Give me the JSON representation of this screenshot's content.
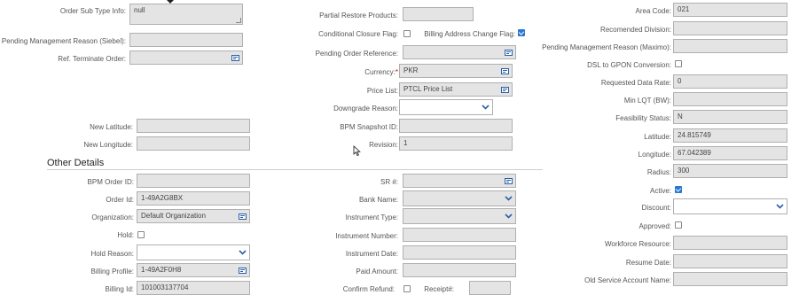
{
  "col1": {
    "order_sub_type_info": {
      "label": "Order Sub Type Info:",
      "value": "null"
    },
    "pending_mgmt_reason_siebel": {
      "label": "Pending Management Reason (Siebel):",
      "value": ""
    },
    "ref_terminate_order": {
      "label": "Ref. Terminate Order:",
      "value": ""
    },
    "new_latitude": {
      "label": "New Latitude:",
      "value": ""
    },
    "new_longitude": {
      "label": "New Longitude:",
      "value": ""
    }
  },
  "col2": {
    "partial_restore_products": {
      "label": "Partial Restore Products:",
      "value": ""
    },
    "conditional_closure_flag": {
      "label": "Conditional Closure Flag:",
      "checked": false
    },
    "billing_address_change_flag": {
      "label": "Billing Address Change Flag:",
      "checked": true
    },
    "pending_order_reference": {
      "label": "Pending Order Reference:",
      "value": ""
    },
    "currency": {
      "label": "Currency:",
      "required_mark": "*",
      "value": "PKR"
    },
    "price_list": {
      "label": "Price List:",
      "value": "PTCL Price List"
    },
    "downgrade_reason": {
      "label": "Downgrade Reason:",
      "value": ""
    },
    "bpm_snapshot_id": {
      "label": "BPM Snapshot ID:",
      "value": ""
    },
    "revision": {
      "label": "Revision:",
      "value": "1"
    }
  },
  "col3": {
    "area_code": {
      "label": "Area Code:",
      "value": "021"
    },
    "recommended_division": {
      "label": "Recomended Division:",
      "value": ""
    },
    "pending_mgmt_reason_maximo": {
      "label": "Pending Management Reason (Maximo):",
      "value": ""
    },
    "dsl_to_gpon": {
      "label": "DSL to GPON Conversion:",
      "checked": false
    },
    "requested_data_rate": {
      "label": "Requested Data Rate:",
      "value": "0"
    },
    "min_lqt": {
      "label": "Min LQT (BW):",
      "value": ""
    },
    "feasibility_status": {
      "label": "Feasibility Status:",
      "value": "N"
    },
    "latitude": {
      "label": "Latitude:",
      "value": "24.815749"
    },
    "longitude": {
      "label": "Longitude:",
      "value": "67.042389"
    },
    "radius": {
      "label": "Radius:",
      "value": "300"
    },
    "active": {
      "label": "Active:",
      "checked": true
    },
    "discount": {
      "label": "Discount:",
      "value": ""
    },
    "approved": {
      "label": "Approved:",
      "checked": false
    },
    "workforce_resource": {
      "label": "Workforce Resource:",
      "value": ""
    },
    "resume_date": {
      "label": "Resume Date:",
      "value": ""
    },
    "old_service_account_name": {
      "label": "Old Service Account Name:",
      "value": ""
    }
  },
  "other_details": {
    "title": "Other Details",
    "bpm_order_id": {
      "label": "BPM Order ID:",
      "value": ""
    },
    "order_id": {
      "label": "Order Id:",
      "value": "1-49A2G8BX"
    },
    "organization": {
      "label": "Organization:",
      "value": "Default Organization"
    },
    "hold": {
      "label": "Hold:",
      "checked": false
    },
    "hold_reason": {
      "label": "Hold Reason:",
      "value": ""
    },
    "billing_profile": {
      "label": "Billing Profile:",
      "value": "1-49A2F0H8"
    },
    "billing_id": {
      "label": "Billing Id:",
      "value": "101003137704"
    },
    "sr_number": {
      "label": "SR #:",
      "value": ""
    },
    "bank_name": {
      "label": "Bank Name:",
      "value": ""
    },
    "instrument_type": {
      "label": "Instrument Type:",
      "value": ""
    },
    "instrument_number": {
      "label": "Instrument Number:",
      "value": ""
    },
    "instrument_date": {
      "label": "Instrument Date:",
      "value": ""
    },
    "paid_amount": {
      "label": "Paid Amount:",
      "value": ""
    },
    "confirm_refund": {
      "label": "Confirm Refund:",
      "checked": false
    },
    "receipt_number": {
      "label": "Receipt#:",
      "value": ""
    }
  },
  "icons": {
    "picker": "picker-icon",
    "dropdown": "chevron-down-icon",
    "checkbox": "checkbox-icon"
  },
  "colors": {
    "field_bg": "#e4e4e4",
    "field_border": "#b0b0b0",
    "checkbox_checked": "#2b78d4",
    "required": "#d00000"
  }
}
